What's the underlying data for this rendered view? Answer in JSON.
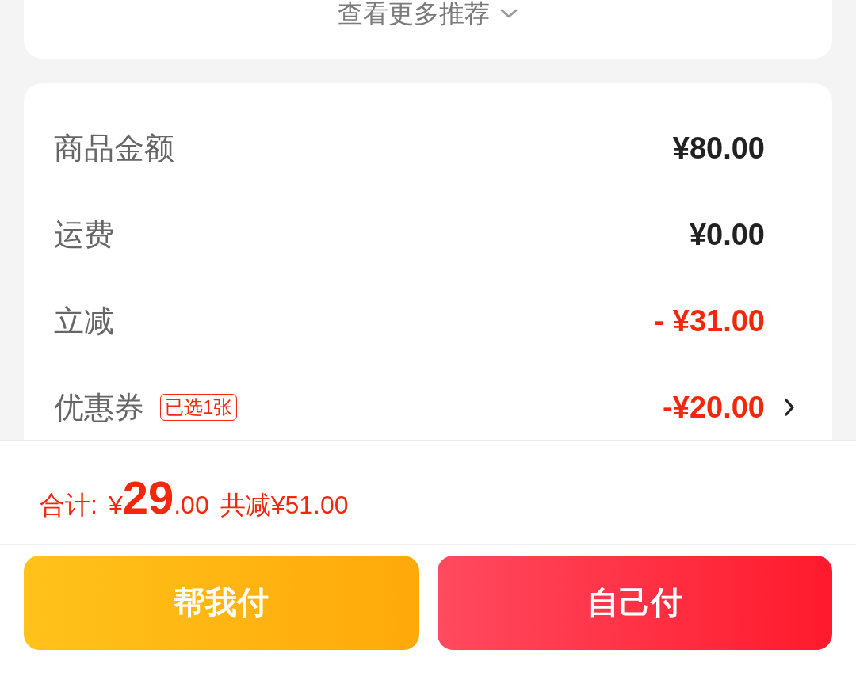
{
  "more_link": {
    "label": "查看更多推荐"
  },
  "summary": {
    "rows": [
      {
        "kind": "charge",
        "label": "商品金额",
        "value": "¥80.00",
        "has_arrow": false
      },
      {
        "kind": "charge",
        "label": "运费",
        "value": "¥0.00",
        "has_arrow": false
      },
      {
        "kind": "discount",
        "label": "立减",
        "value": "- ¥31.00",
        "has_arrow": false
      },
      {
        "kind": "discount",
        "label": "优惠券",
        "tag": "已选1张",
        "value": "-¥20.00",
        "has_arrow": true
      }
    ]
  },
  "total": {
    "label": "合计:",
    "currency": "¥",
    "integer": "29",
    "decimal": ".00",
    "savings": "共减¥51.00"
  },
  "buttons": [
    {
      "kind": "secondary",
      "label": "帮我付"
    },
    {
      "kind": "primary",
      "label": "自己付"
    }
  ]
}
